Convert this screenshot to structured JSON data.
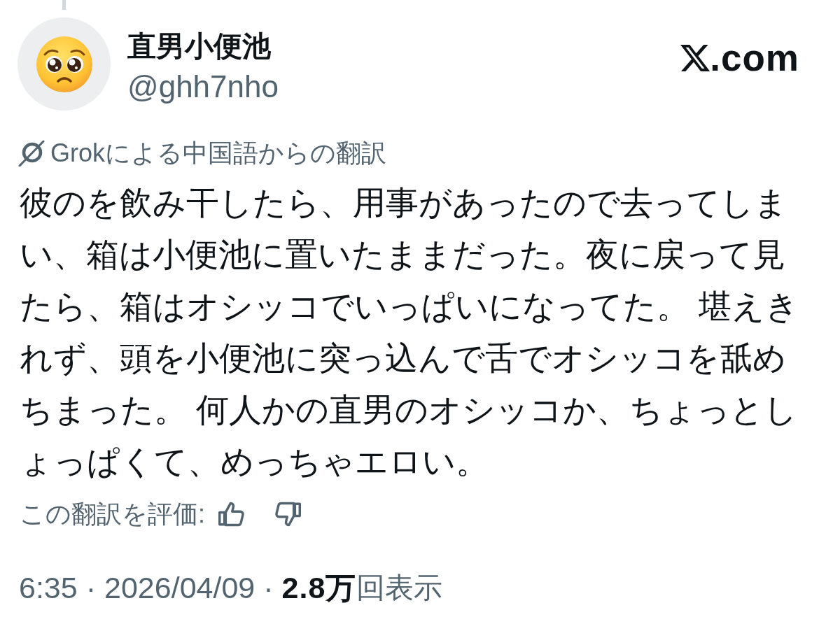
{
  "author": {
    "display_name": "直男小便池",
    "handle": "@ghh7nho"
  },
  "site_badge": {
    "text": ".com"
  },
  "translation_note": {
    "text": "Grokによる中国語からの翻訳"
  },
  "post_text": "彼のを飲み干したら、用事があったので去ってしまい、箱は小便池に置いたままだった。夜に戻って見たら、箱はオシッコでいっぱいになってた。 堪えきれず、頭を小便池に突っ込んで舌でオシッコを舐めちまった。 何人かの直男のオシッコか、ちょっとしょっぱくて、めっちゃエロい。",
  "rating": {
    "label": "この翻訳を評価:"
  },
  "meta": [
    {
      "kind": "time",
      "text": "6:35"
    },
    {
      "kind": "separator",
      "text": "·"
    },
    {
      "kind": "date",
      "text": "2026/04/09"
    },
    {
      "kind": "separator",
      "text": "·"
    },
    {
      "kind": "count",
      "text": "2.8万"
    },
    {
      "kind": "label",
      "text": "回表示"
    }
  ]
}
